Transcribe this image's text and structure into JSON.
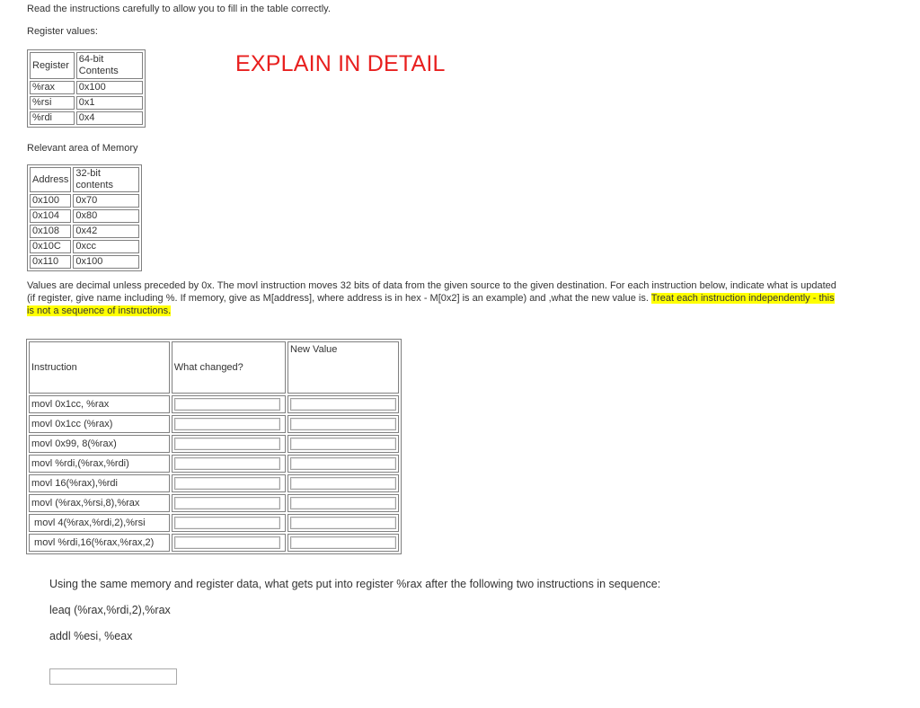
{
  "intro": "Read the instructions carefully to allow you to fill in the table correctly.",
  "register_section_title": "Register values:",
  "register_table": {
    "headers": [
      "Register",
      "64-bit Contents"
    ],
    "rows": [
      [
        "%rax",
        "0x100"
      ],
      [
        "%rsi",
        "0x1"
      ],
      [
        "%rdi",
        "0x4"
      ]
    ]
  },
  "overlay_note": "EXPLAIN IN DETAIL",
  "memory_section_title": "Relevant area of Memory",
  "memory_table": {
    "headers": [
      "Address",
      "32-bit contents"
    ],
    "rows": [
      [
        "0x100",
        "0x70"
      ],
      [
        "0x104",
        "0x80"
      ],
      [
        "0x108",
        "0x42"
      ],
      [
        "0x10C",
        "0xcc"
      ],
      [
        "0x110",
        "0x100"
      ]
    ]
  },
  "instructions_text": {
    "line1": "Values are decimal unless preceded by 0x. The movl instruction moves 32 bits of data from the given source to the given destination.  For each instruction below, indicate what is updated",
    "line2_plain": "(if register, give name including %.   If memory, give as M[address], where address is in hex - M[0x2] is an example) and ,what the new value is.  ",
    "line2_highlight": "Treat each instruction independently - this",
    "line3_highlight": "is not a sequence of instructions."
  },
  "answer_table": {
    "headers": [
      "Instruction",
      "What changed?",
      "New Value"
    ],
    "rows": [
      "movl 0x1cc, %rax",
      "movl 0x1cc (%rax)",
      "movl 0x99, 8(%rax)",
      "movl %rdi,(%rax,%rdi)",
      "movl 16(%rax),%rdi",
      "movl (%rax,%rsi,8),%rax",
      " movl 4(%rax,%rdi,2),%rsi",
      " movl %rdi,16(%rax,%rax,2)"
    ]
  },
  "sequence_question": {
    "prompt": "Using the same memory and register data, what gets put into register %rax after the following two instructions in sequence:",
    "instr1": "leaq (%rax,%rdi,2),%rax",
    "instr2": "addl %esi, %eax"
  },
  "colors": {
    "highlight": "#ffff00",
    "explain": "#e8201f"
  }
}
